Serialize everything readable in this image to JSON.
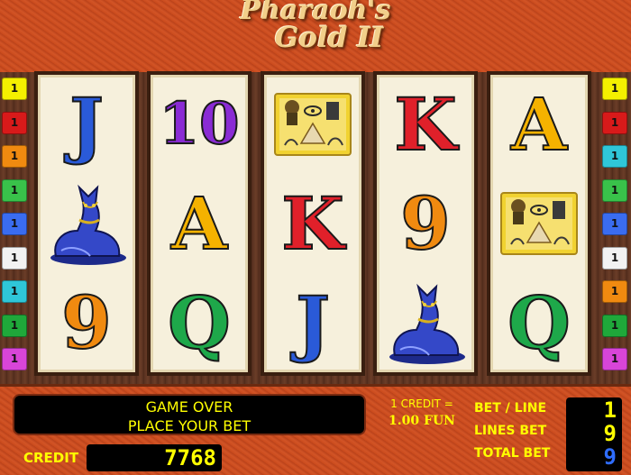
{
  "game": {
    "title_line1": "Pharaoh's",
    "title_line2": "Gold II"
  },
  "lines": {
    "left": [
      {
        "label": "1",
        "color": "#f4f000"
      },
      {
        "label": "1",
        "color": "#d81a1a"
      },
      {
        "label": "1",
        "color": "#f08a10"
      },
      {
        "label": "1",
        "color": "#39c24a"
      },
      {
        "label": "1",
        "color": "#3a6cf0"
      },
      {
        "label": "1",
        "color": "#f2f2f2"
      },
      {
        "label": "1",
        "color": "#2fc6d8"
      },
      {
        "label": "1",
        "color": "#1fa83a"
      },
      {
        "label": "1",
        "color": "#d845d8"
      }
    ],
    "right": [
      {
        "label": "1",
        "color": "#f4f000"
      },
      {
        "label": "1",
        "color": "#d81a1a"
      },
      {
        "label": "1",
        "color": "#2fc6d8"
      },
      {
        "label": "1",
        "color": "#39c24a"
      },
      {
        "label": "1",
        "color": "#3a6cf0"
      },
      {
        "label": "1",
        "color": "#f2f2f2"
      },
      {
        "label": "1",
        "color": "#f08a10"
      },
      {
        "label": "1",
        "color": "#1fa83a"
      },
      {
        "label": "1",
        "color": "#d845d8"
      }
    ]
  },
  "reels": [
    {
      "symbols": [
        {
          "type": "card",
          "text": "J"
        },
        {
          "type": "icon",
          "icon": "cat-statue-icon"
        },
        {
          "type": "card",
          "text": "9"
        }
      ]
    },
    {
      "symbols": [
        {
          "type": "card",
          "text": "10"
        },
        {
          "type": "card",
          "text": "A"
        },
        {
          "type": "card",
          "text": "Q"
        }
      ]
    },
    {
      "symbols": [
        {
          "type": "icon",
          "icon": "papyrus-pyramid-icon"
        },
        {
          "type": "card",
          "text": "K"
        },
        {
          "type": "card",
          "text": "J"
        }
      ]
    },
    {
      "symbols": [
        {
          "type": "card",
          "text": "K"
        },
        {
          "type": "card",
          "text": "9"
        },
        {
          "type": "icon",
          "icon": "cat-statue-icon"
        }
      ]
    },
    {
      "symbols": [
        {
          "type": "card",
          "text": "A"
        },
        {
          "type": "icon",
          "icon": "papyrus-pyramid-icon"
        },
        {
          "type": "card",
          "text": "Q"
        }
      ]
    }
  ],
  "panel": {
    "message_line1": "GAME OVER",
    "message_line2": "PLACE YOUR BET",
    "credit_label": "CREDIT",
    "credit_value": "7768",
    "rate_line1": "1 CREDIT =",
    "rate_line2": "1.00 FUN",
    "bet_line_label": "BET / LINE",
    "lines_bet_label": "LINES BET",
    "total_bet_label": "TOTAL BET",
    "bet_line_value": "1",
    "lines_bet_value": "9",
    "total_bet_value": "9"
  },
  "colors": {
    "frame": "#c94a1c",
    "display_text": "#ffff00"
  }
}
